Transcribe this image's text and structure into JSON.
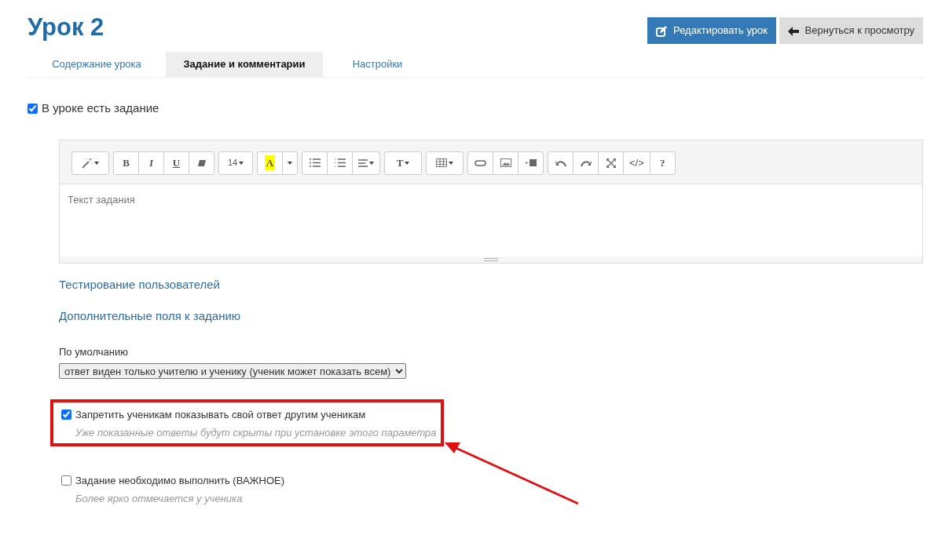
{
  "title": "Урок 2",
  "actions": [
    {
      "kind": "edit",
      "label": "Редактировать урок"
    },
    {
      "kind": "back",
      "label": "Вернуться к просмотру"
    }
  ],
  "tabs": [
    {
      "label": "Содержание урока",
      "selected": false
    },
    {
      "label": "Задание и комментарии",
      "selected": true
    },
    {
      "label": "Настройки",
      "selected": false
    }
  ],
  "has_task": {
    "label": "В уроке есть задание",
    "checked": true
  },
  "editor": {
    "toolbar": [
      [
        {
          "kind": "magic"
        }
      ],
      [
        {
          "kind": "bold",
          "label": "B"
        },
        {
          "kind": "italic",
          "label": "I"
        },
        {
          "kind": "underline",
          "label": "U"
        },
        {
          "kind": "eraser"
        }
      ],
      [
        {
          "kind": "fontsize",
          "label": "14"
        }
      ],
      [
        {
          "kind": "color",
          "label": "A"
        },
        {
          "kind": "caret"
        }
      ],
      [
        {
          "kind": "ul"
        },
        {
          "kind": "ol"
        },
        {
          "kind": "align"
        }
      ],
      [
        {
          "kind": "lineheight",
          "label": "T"
        }
      ],
      [
        {
          "kind": "table"
        }
      ],
      [
        {
          "kind": "link"
        },
        {
          "kind": "picture"
        },
        {
          "kind": "video"
        }
      ],
      [
        {
          "kind": "undo"
        },
        {
          "kind": "redo"
        },
        {
          "kind": "fullscreen"
        },
        {
          "kind": "code",
          "label": "</>"
        },
        {
          "kind": "help",
          "label": "?"
        }
      ]
    ],
    "placeholder": "Текст задания"
  },
  "links": [
    "Тестирование пользователей",
    "Дополнительные поля к заданию"
  ],
  "visibility": {
    "label": "По умолчанию",
    "value": "ответ виден только учителю и ученику (ученик может показать всем)"
  },
  "options": [
    {
      "label": "Запретить ученикам показывать свой ответ другим ученикам",
      "hint": "Уже показанные ответы будут скрыты при установке этого параметра",
      "checked": true,
      "highlighted": true
    },
    {
      "label": "Задание необходимо выполнить (ВАЖНОЕ)",
      "hint": "Более ярко отмечается у ученика",
      "checked": false,
      "highlighted": false
    }
  ]
}
